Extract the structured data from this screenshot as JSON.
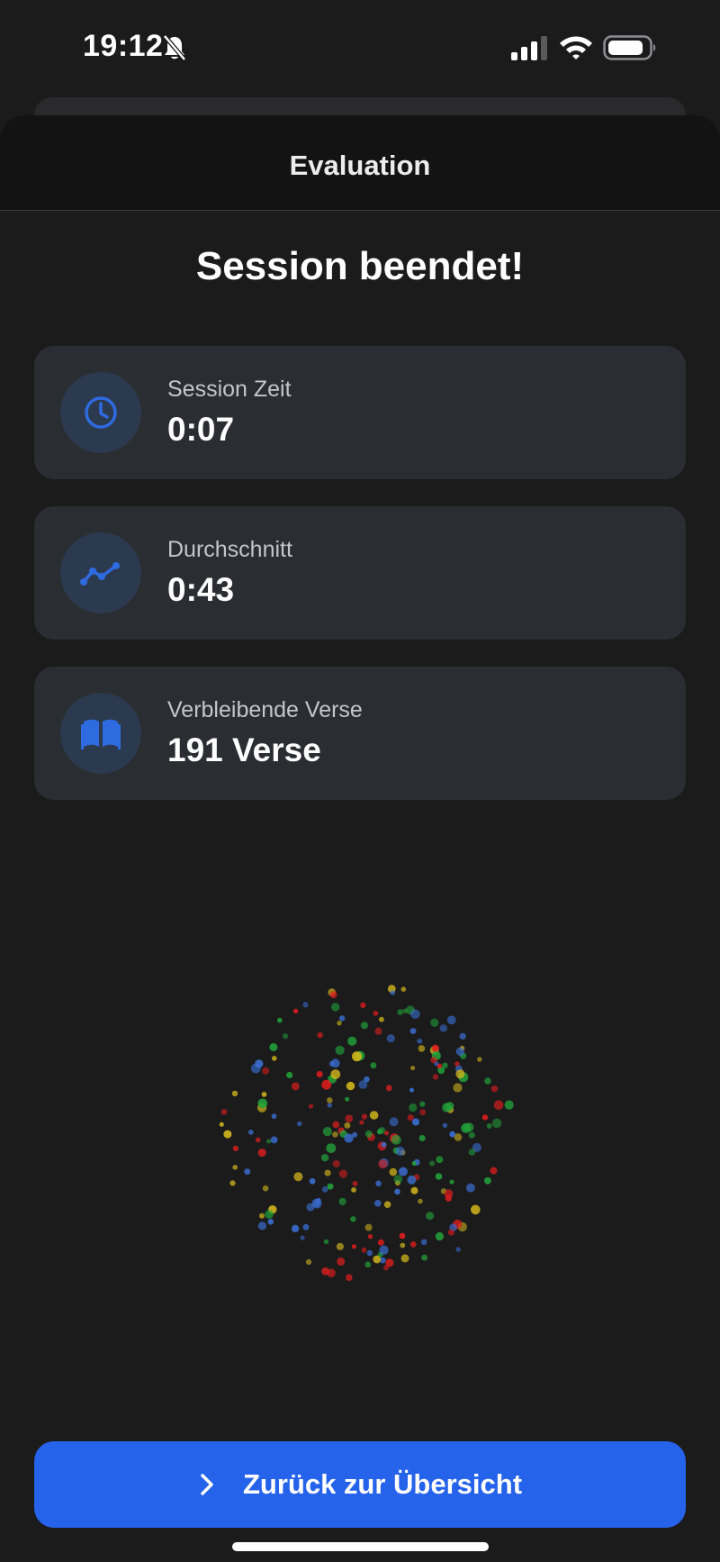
{
  "status_bar": {
    "time": "19:12",
    "icons": [
      "bell-slash-icon",
      "signal-icon",
      "wifi-icon",
      "battery-icon"
    ]
  },
  "sheet": {
    "title": "Evaluation",
    "headline": "Session beendet!"
  },
  "stats": [
    {
      "label": "Session Zeit",
      "value": "0:07",
      "icon": "clock-icon"
    },
    {
      "label": "Durchschnitt",
      "value": "0:43",
      "icon": "trend-line-icon"
    },
    {
      "label": "Verbleibende Verse",
      "value": "191 Verse",
      "icon": "open-book-icon"
    }
  ],
  "confetti": {
    "colors": [
      "#e11d1d",
      "#d4b81c",
      "#22a33a",
      "#3b6fd4"
    ]
  },
  "back_button": {
    "label": "Zurück zur Übersicht",
    "icon": "chevron-right-icon"
  },
  "colors": {
    "background": "#1b1b1c",
    "card": "#2a2d31",
    "icon_circle": "#2c3a4f",
    "accent": "#2563eb"
  }
}
